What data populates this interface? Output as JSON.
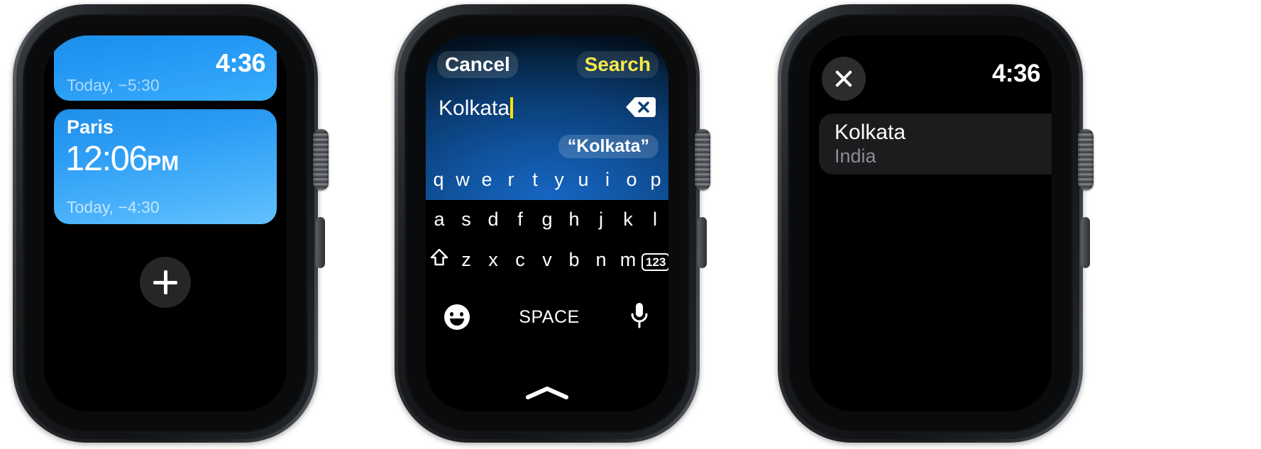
{
  "watch_world_clock": {
    "name": "world-clock-list",
    "cards": [
      {
        "city": "",
        "time": "4:36",
        "ampm": "",
        "subtitle": "Today, −5:30",
        "partial": true
      },
      {
        "city": "Paris",
        "time": "12:06",
        "ampm": "PM",
        "subtitle": "Today, −4:30",
        "partial": false
      }
    ],
    "add_button_label": "+"
  },
  "watch_search": {
    "name": "city-search-keyboard",
    "cancel_label": "Cancel",
    "search_label": "Search",
    "input_value": "Kolkata",
    "input_placeholder": "",
    "delete_icon": "backspace-delete-icon",
    "suggestion": "“Kolkata”",
    "keyboard": {
      "row1": [
        "q",
        "w",
        "e",
        "r",
        "t",
        "y",
        "u",
        "i",
        "o",
        "p"
      ],
      "row2": [
        "a",
        "s",
        "d",
        "f",
        "g",
        "h",
        "j",
        "k",
        "l"
      ],
      "row3": [
        "z",
        "x",
        "c",
        "v",
        "b",
        "n",
        "m"
      ],
      "shift_key": "⇧",
      "numbers_key": "123",
      "space_label": "SPACE",
      "emoji_key": "emoji-face-icon",
      "dictation_key": "microphone-icon",
      "handle": "chevron-up-handle"
    },
    "colors": {
      "search_accent": "#f5e94b",
      "caret": "#ffe400",
      "keyboard_backdrop": "#1766c4"
    }
  },
  "watch_result": {
    "name": "search-results",
    "close_label": "✕",
    "time": "4:36",
    "results": [
      {
        "city": "Kolkata",
        "country": "India"
      }
    ]
  }
}
